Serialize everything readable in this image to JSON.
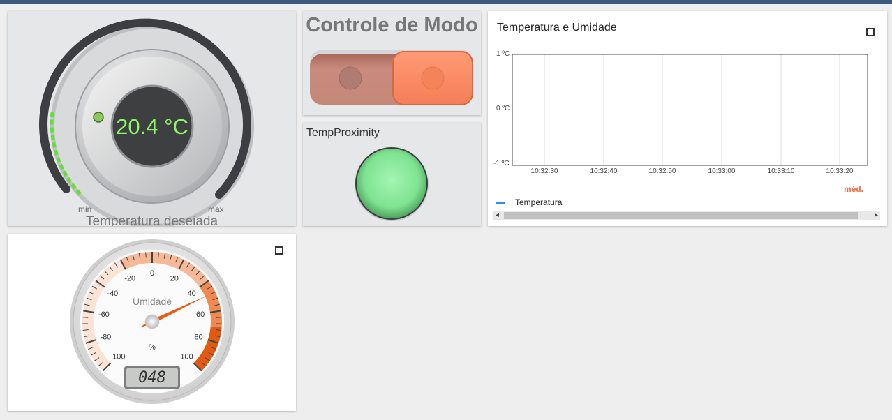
{
  "knob": {
    "value": "20.4 °C",
    "min_label": "min",
    "max_label": "max",
    "title": "Temperatura deseiada"
  },
  "mode": {
    "title": "Controle de Modo",
    "state": "on"
  },
  "proximity": {
    "title": "TempProximity",
    "led_color": "#7ee391"
  },
  "chart": {
    "title": "Temperatura e Umidade",
    "y_ticks": [
      "1 ºC",
      "0 ºC",
      "-1 ºC"
    ],
    "x_ticks": [
      "10:32:30",
      "10:32:40",
      "10:32:50",
      "10:33:00",
      "10:33:10",
      "10:33:20"
    ],
    "stat_label": "méd.",
    "legend_label": "Temperatura",
    "series_color": "#2196f3"
  },
  "gauge": {
    "label": "Umidade",
    "unit": "%",
    "ticks": [
      "-100",
      "-80",
      "-60",
      "-40",
      "-20",
      "0",
      "20",
      "40",
      "60",
      "80",
      "100"
    ],
    "value": 48,
    "display": "048"
  },
  "chart_data": {
    "type": "line",
    "title": "Temperatura e Umidade",
    "x": [
      "10:32:30",
      "10:32:40",
      "10:32:50",
      "10:33:00",
      "10:33:10",
      "10:33:20"
    ],
    "ylim": [
      -1,
      1
    ],
    "ylabel": "",
    "xlabel": "",
    "series": [
      {
        "name": "Temperatura",
        "values": []
      }
    ],
    "grid": true,
    "legend": "bottom-left"
  }
}
